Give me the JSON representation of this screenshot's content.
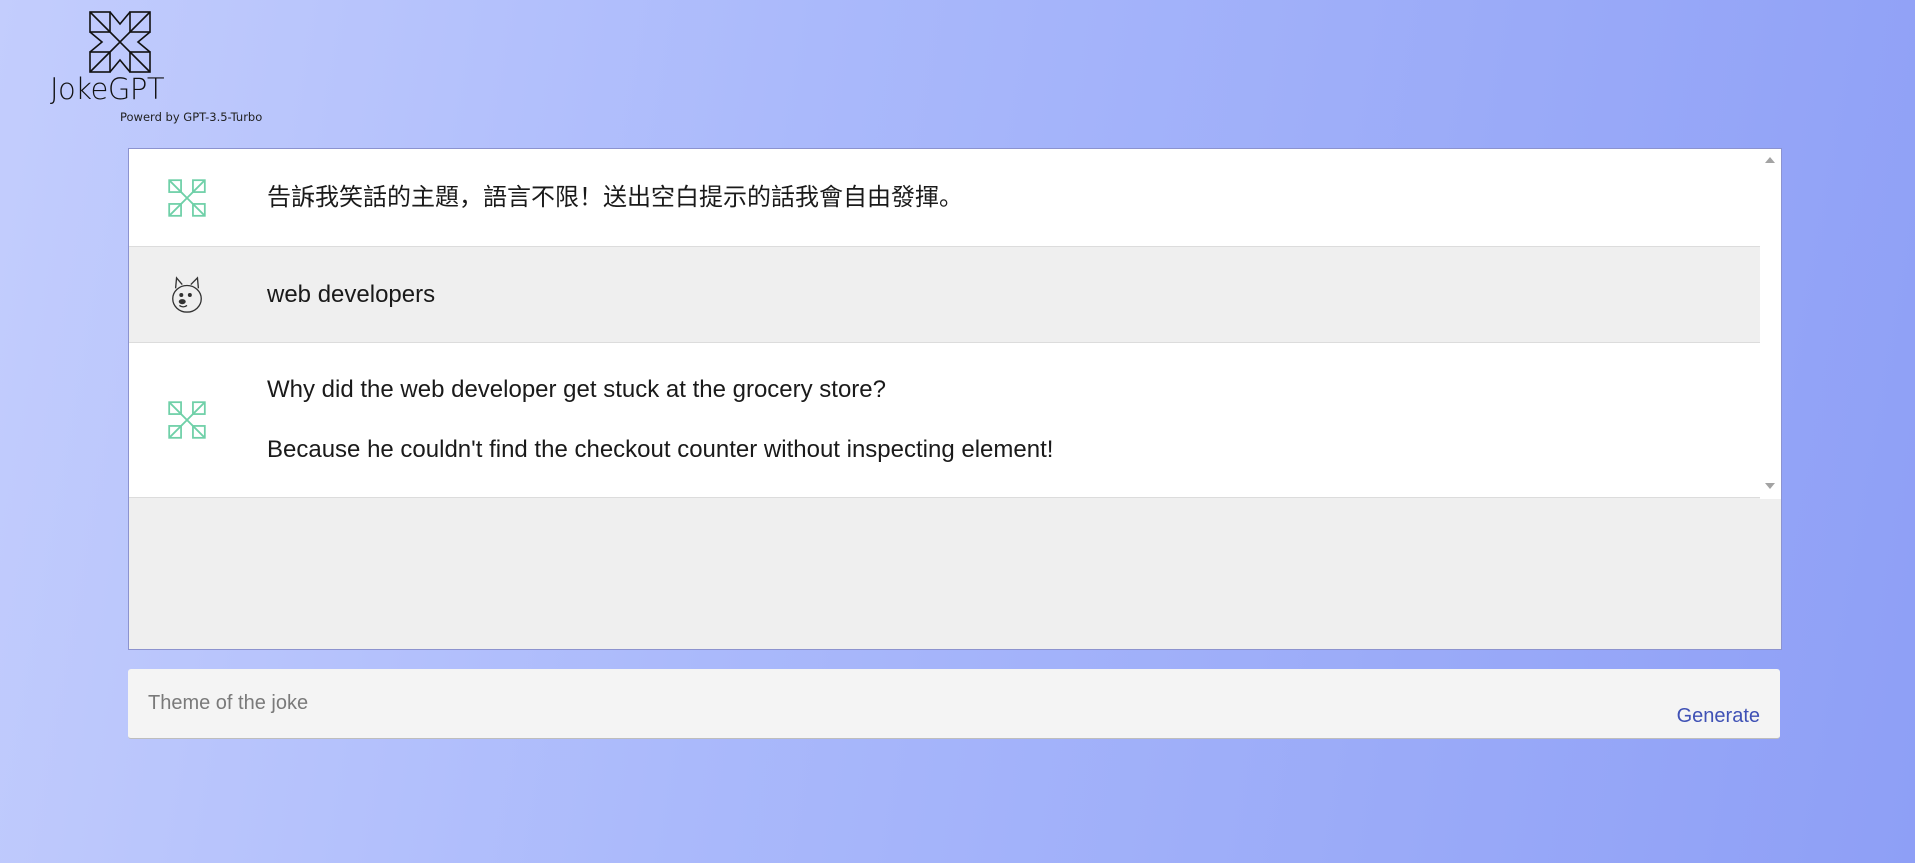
{
  "brand": {
    "title": "JokeGPT",
    "subtitle": "Powerd by GPT-3.5-Turbo"
  },
  "messages": [
    {
      "role": "bot",
      "avatar_icon": "jokegpt-logo-icon",
      "paragraphs": [
        "告訴我笑話的主題，語言不限！送出空白提示的話我會自由發揮。"
      ]
    },
    {
      "role": "user",
      "avatar_icon": "doge-icon",
      "paragraphs": [
        "web developers"
      ]
    },
    {
      "role": "bot",
      "avatar_icon": "jokegpt-logo-icon",
      "paragraphs": [
        "Why did the web developer get stuck at the grocery store?",
        "Because he couldn't find the checkout counter without inspecting element!"
      ]
    }
  ],
  "input": {
    "placeholder": "Theme of the joke",
    "value": ""
  },
  "generate_label": "Generate",
  "colors": {
    "accent": "#3f51b5",
    "bot_icon": "#6fd0a8",
    "bot_row": "#ffffff",
    "user_row": "#efefef"
  }
}
